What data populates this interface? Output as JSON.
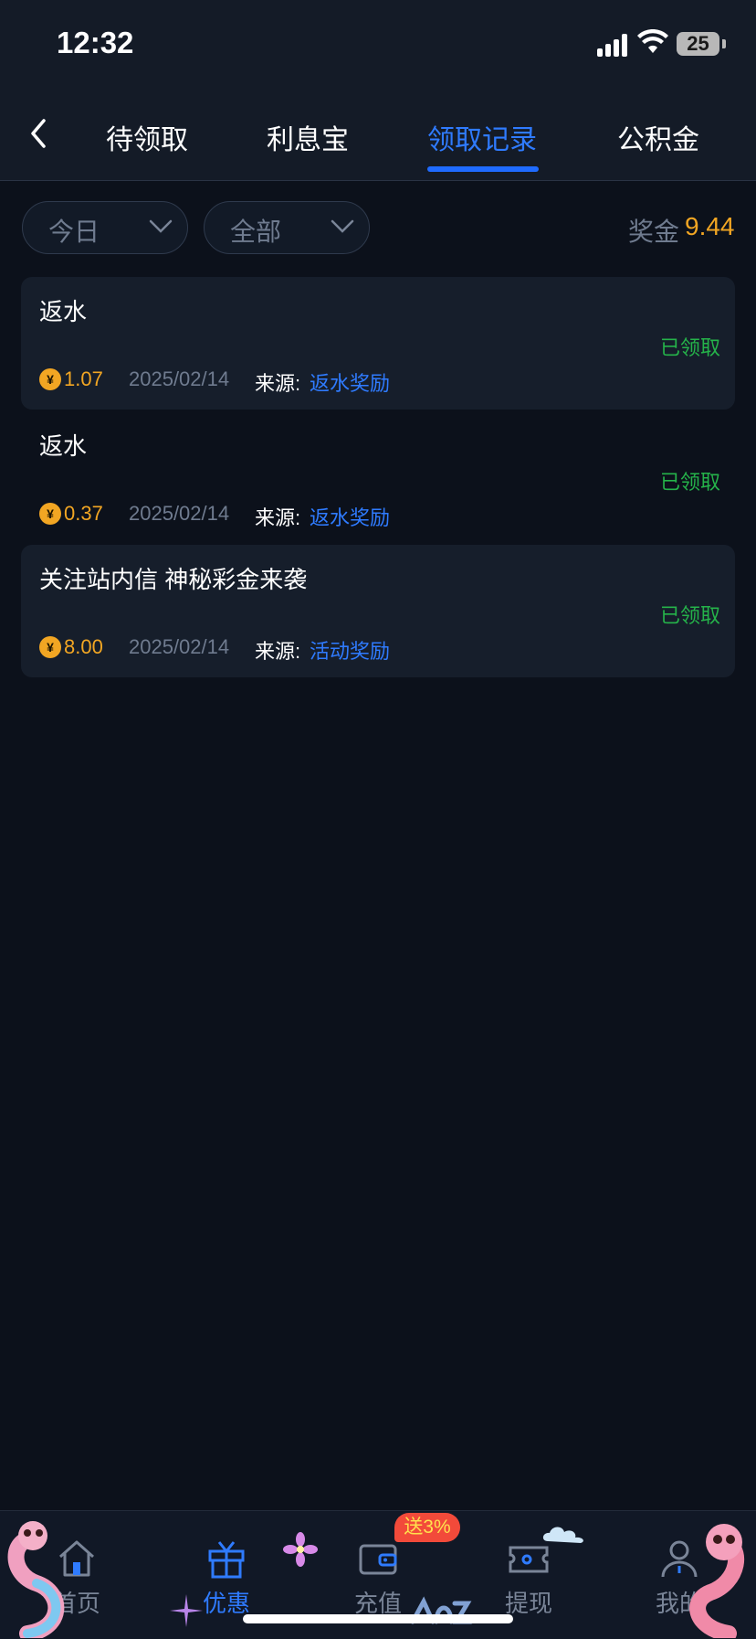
{
  "status_bar": {
    "time": "12:32",
    "battery": "25"
  },
  "tabs": [
    {
      "label": "待领取",
      "active": false
    },
    {
      "label": "利息宝",
      "active": false
    },
    {
      "label": "领取记录",
      "active": true
    },
    {
      "label": "公积金",
      "active": false
    }
  ],
  "filters": {
    "date": "今日",
    "type": "全部"
  },
  "bonus": {
    "label": "奖金",
    "value": "9.44"
  },
  "records": [
    {
      "title": "返水",
      "status": "已领取",
      "amount": "1.07",
      "date": "2025/02/14",
      "source_label": "来源:",
      "source": "返水奖励",
      "coin": "¥"
    },
    {
      "title": "返水",
      "status": "已领取",
      "amount": "0.37",
      "date": "2025/02/14",
      "source_label": "来源:",
      "source": "返水奖励",
      "coin": "¥"
    },
    {
      "title": "关注站内信 神秘彩金来袭",
      "status": "已领取",
      "amount": "8.00",
      "date": "2025/02/14",
      "source_label": "来源:",
      "source": "活动奖励",
      "coin": "¥"
    }
  ],
  "bottom_nav": [
    {
      "label": "首页",
      "icon": "home-icon",
      "active": false
    },
    {
      "label": "优惠",
      "icon": "gift-icon",
      "active": true
    },
    {
      "label": "充值",
      "icon": "wallet-icon",
      "active": false
    },
    {
      "label": "提现",
      "icon": "ticket-icon",
      "active": false
    },
    {
      "label": "我的",
      "icon": "user-icon",
      "active": false
    }
  ],
  "promo_badge": "送3%",
  "colors": {
    "accent": "#2f7bff",
    "gold": "#f2a623",
    "success": "#25b34a",
    "background": "#0c111b"
  }
}
